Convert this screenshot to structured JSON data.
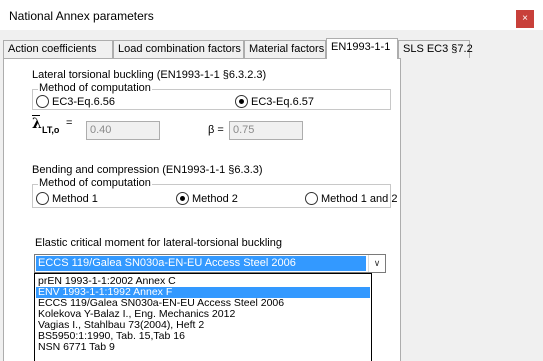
{
  "window": {
    "title": "National Annex parameters",
    "close_glyph": "×"
  },
  "tabs": [
    {
      "label": "Action coefficients"
    },
    {
      "label": "Load combination factors"
    },
    {
      "label": "Material factors"
    },
    {
      "label": "EN1993-1-1"
    },
    {
      "label": "SLS EC3 §7.2"
    }
  ],
  "ltb": {
    "heading": "Lateral torsional buckling (EN1993-1-1 §6.3.2.3)",
    "group_label": "Method of computation",
    "option1": "EC3-Eq.6.56",
    "option2": "EC3-Eq.6.57",
    "selected": "EC3-Eq.6.57",
    "lambda_symbol": "λ",
    "lambda_sub": "LT,o",
    "lambda_eq": "=",
    "lambda_value": "0.40",
    "beta_label": "β =",
    "beta_value": "0.75"
  },
  "bending": {
    "heading": "Bending and compression (EN1993-1-1 §6.3.3)",
    "group_label": "Method of computation",
    "option1": "Method 1",
    "option2": "Method 2",
    "option3": "Method 1 and 2",
    "selected": "Method 2"
  },
  "critical_moment": {
    "label": "Elastic critical moment for lateral-torsional buckling",
    "selected": "ECCS 119/Galea SN030a-EN-EU Access Steel 2006",
    "options": [
      "prEN 1993-1-1:2002 Annex C",
      "ENV 1993-1-1:1992 Annex F",
      "ECCS 119/Galea SN030a-EN-EU Access Steel 2006",
      "Kolekova Y-Balaz I., Eng. Mechanics 2012",
      "Vagias I., Stahlbau 73(2004), Heft 2",
      "BS5950:1:1990, Tab. 15,Tab 16",
      "NSN 6771 Tab 9"
    ],
    "highlighted": "ENV 1993-1-1:1992 Annex F"
  }
}
